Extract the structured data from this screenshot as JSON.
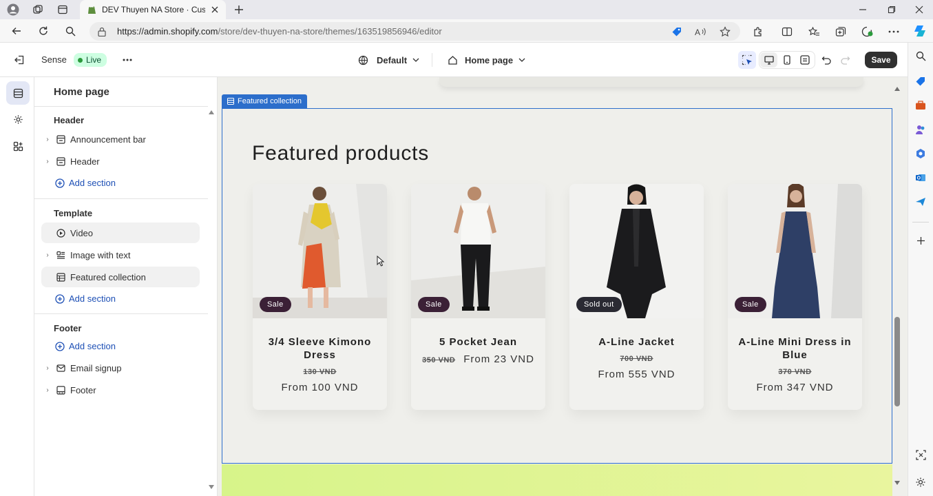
{
  "browser": {
    "tab_title": "DEV Thuyen NA Store · Customiz",
    "url_host": "https://admin.shopify.com",
    "url_path": "/store/dev-thuyen-na-store/themes/163519856946/editor"
  },
  "editor": {
    "theme_name": "Sense",
    "status": "Live",
    "theme_setting": "Default",
    "page_select": "Home page",
    "save_label": "Save"
  },
  "panel": {
    "title": "Home page",
    "header_group": "Header",
    "header_items": [
      "Announcement bar",
      "Header"
    ],
    "template_group": "Template",
    "template_items": [
      "Video",
      "Image with text",
      "Featured collection"
    ],
    "footer_group": "Footer",
    "footer_items": [
      "Email signup",
      "Footer"
    ],
    "add_section": "Add section"
  },
  "preview": {
    "section_label": "Featured collection",
    "heading": "Featured products",
    "products": [
      {
        "badge": "Sale",
        "title": "3/4 Sleeve Kimono Dress",
        "old_price": "130 VND",
        "price": "From 100 VND"
      },
      {
        "badge": "Sale",
        "title": "5 Pocket Jean",
        "old_price": "350 VND",
        "price": "From 23 VND"
      },
      {
        "badge": "Sold out",
        "title": "A-Line Jacket",
        "old_price": "700 VND",
        "price": "From 555 VND"
      },
      {
        "badge": "Sale",
        "title": "A-Line Mini Dress in Blue",
        "old_price": "370 VND",
        "price": "From 347 VND"
      }
    ]
  },
  "colors": {
    "accent_blue": "#2c6ecb",
    "live_green": "#2b9a3c",
    "sale_badge": "#3b2036",
    "band_green": "#d7f48a"
  }
}
